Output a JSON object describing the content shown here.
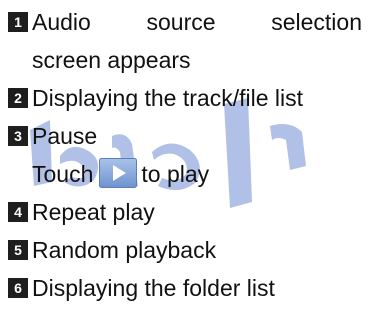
{
  "items": [
    {
      "number": "1",
      "line1": "Audio source selection",
      "line2": "screen appears"
    },
    {
      "number": "2",
      "text": "Displaying the track/file list"
    },
    {
      "number": "3",
      "text": "Pause",
      "line2_before": "Touch",
      "line2_after": "to play",
      "icon": "play-icon"
    },
    {
      "number": "4",
      "text": "Repeat play"
    },
    {
      "number": "5",
      "text": "Random playback"
    },
    {
      "number": "6",
      "text": "Displaying the folder list"
    }
  ],
  "colors": {
    "badge": "#1e1e1e",
    "text": "#111111",
    "play_button": "#7a9fd6",
    "watermark": "#4f74c8"
  }
}
